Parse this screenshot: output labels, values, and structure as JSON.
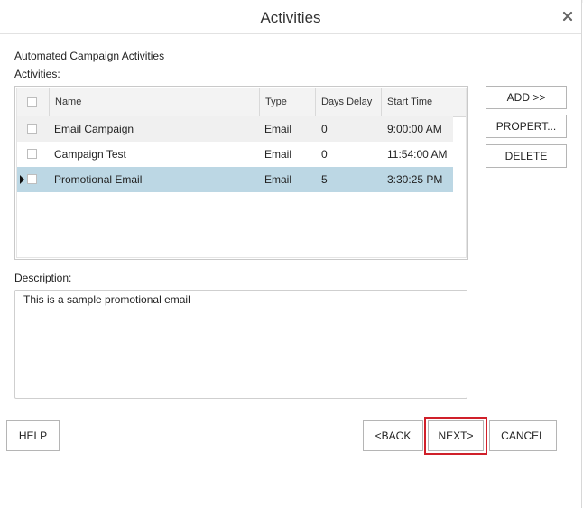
{
  "dialog": {
    "title": "Activities",
    "section_title": "Automated Campaign Activities",
    "activities_label": "Activities:",
    "description_label": "Description:",
    "description_value": "This is a sample promotional email"
  },
  "grid": {
    "columns": [
      "Name",
      "Type",
      "Days Delay",
      "Start Time"
    ],
    "rows": [
      {
        "name": "Email Campaign",
        "type": "Email",
        "days_delay": "0",
        "start_time": "9:00:00 AM"
      },
      {
        "name": "Campaign Test",
        "type": "Email",
        "days_delay": "0",
        "start_time": "11:54:00 AM"
      },
      {
        "name": "Promotional Email",
        "type": "Email",
        "days_delay": "5",
        "start_time": "3:30:25 PM",
        "selected": true
      }
    ]
  },
  "side_buttons": {
    "add": "ADD >>",
    "properties": "PROPERT...",
    "delete": "DELETE"
  },
  "footer_buttons": {
    "help": "HELP",
    "back": "<BACK",
    "next": "NEXT>",
    "cancel": "CANCEL"
  },
  "colors": {
    "selected_row": "#bcd7e4",
    "highlight_border": "#d0202a"
  },
  "icons": {
    "close": "close-icon",
    "row_pointer": "current-row-pointer-icon"
  }
}
